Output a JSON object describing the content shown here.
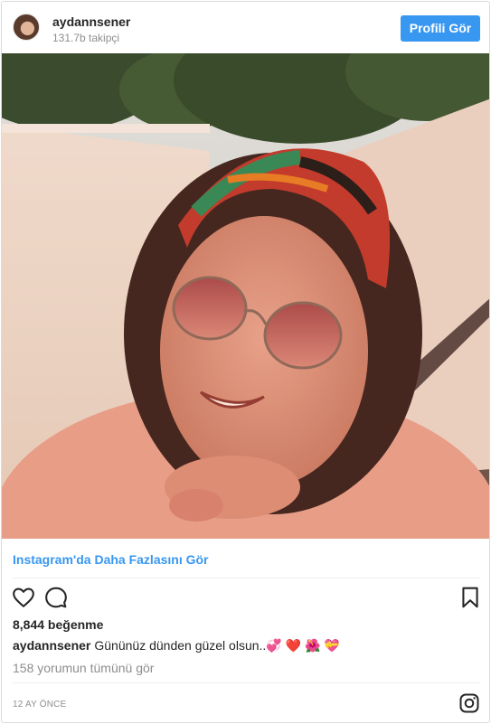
{
  "header": {
    "username": "aydannsener",
    "followers": "131.7b takipçi",
    "view_profile_label": "Profili Gör"
  },
  "photo": {
    "icon": "user-photo"
  },
  "more_link": "Instagram'da Daha Fazlasını Gör",
  "actions": {
    "like_icon": "heart-icon",
    "comment_icon": "comment-icon",
    "save_icon": "bookmark-icon"
  },
  "likes": "8,844 beğenme",
  "caption": {
    "username": "aydannsener",
    "text": "Gününüz dünden güzel olsun..💞 ❤️ 🌺 💝"
  },
  "comments_link": "158 yorumun tümünü gör",
  "timestamp": "12 AY ÖNCE",
  "footer_icon": "instagram-icon",
  "colors": {
    "accent": "#3897f0",
    "text": "#262626",
    "muted": "#8e8e8e"
  }
}
